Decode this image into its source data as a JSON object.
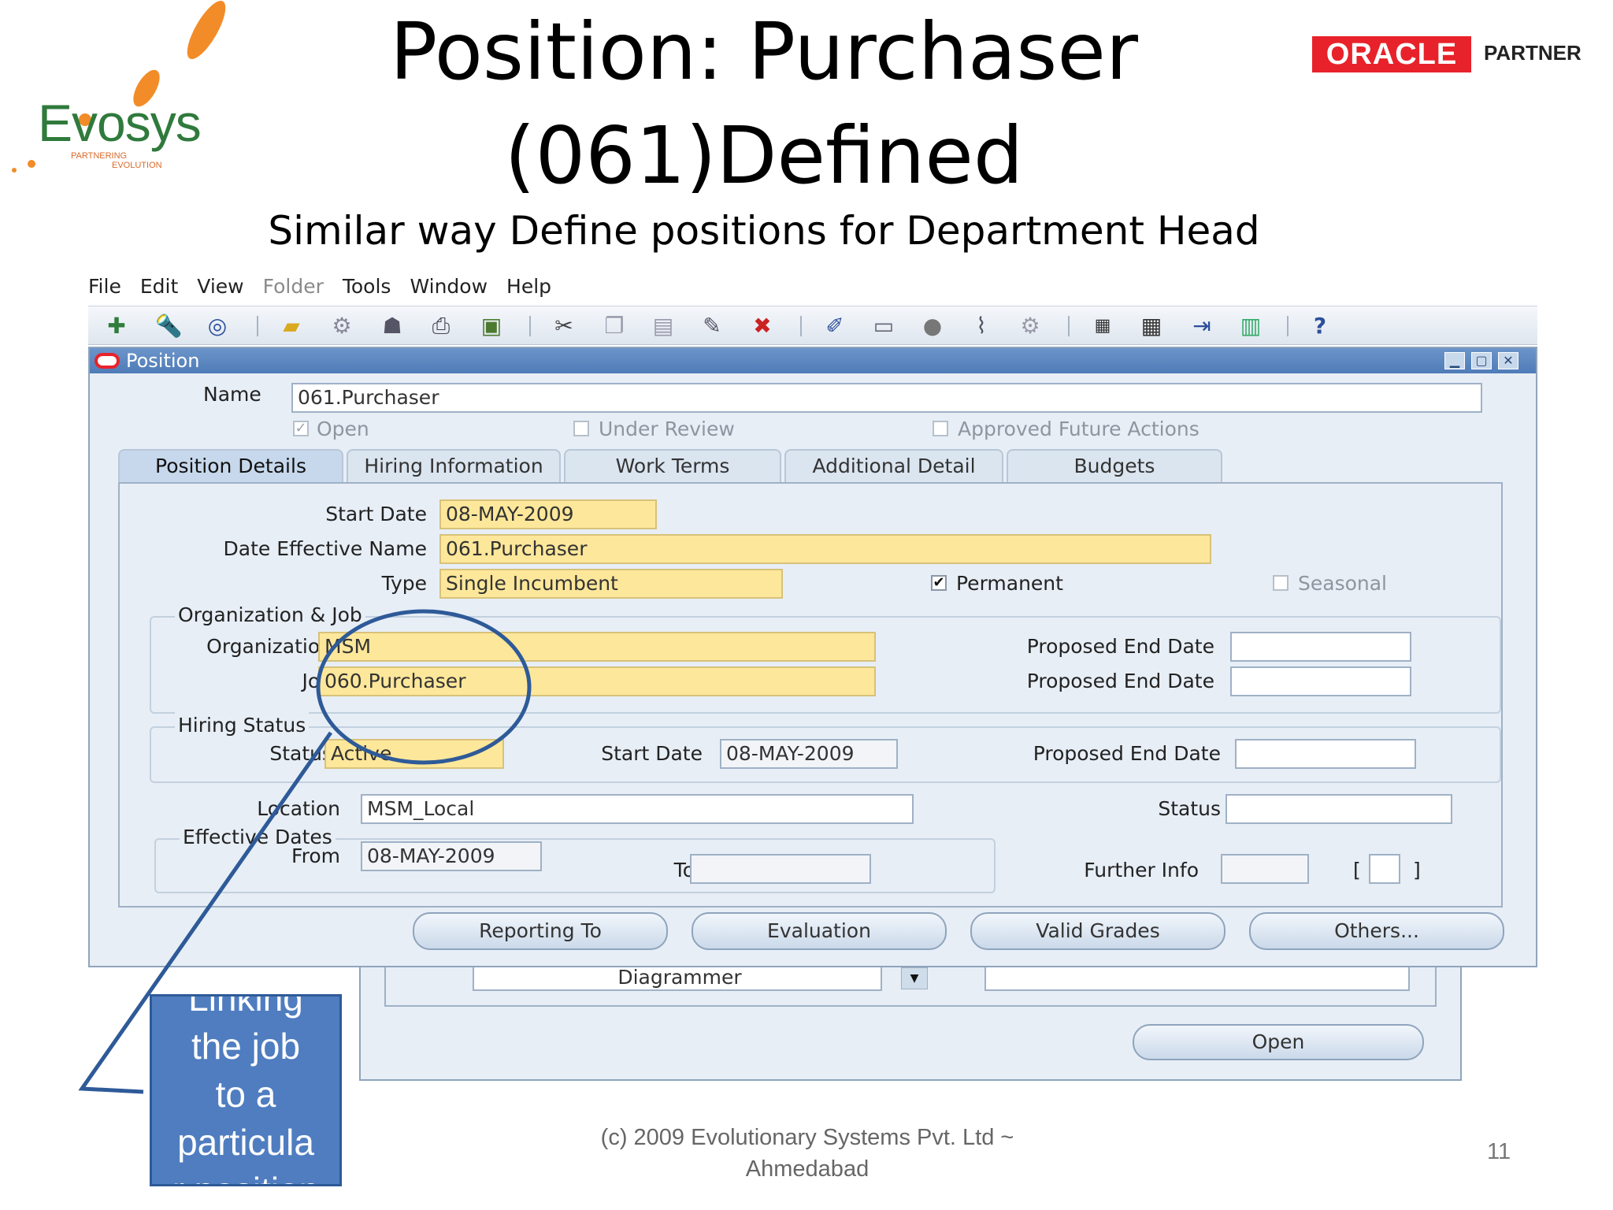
{
  "slide": {
    "title_line1": "Position: Purchaser",
    "title_line2": "(061)Defined",
    "subtitle": "Similar way Define  positions for Department Head",
    "footer_line1": "(c) 2009 Evolutionary Systems Pvt. Ltd ~",
    "footer_line2": "Ahmedabad",
    "page_number": "11",
    "callout_lines": [
      "Linking",
      "the job",
      "to  a",
      "particula",
      "r position"
    ]
  },
  "logos": {
    "evosys_text": "Evosys",
    "evosys_tag_line1": "PARTNERING",
    "evosys_tag_line2": "EVOLUTION",
    "oracle_text": "ORACLE",
    "partner_text": "PARTNER",
    "oracle_color": "#e8222a",
    "evosys_orange": "#f28c28",
    "evosys_green": "#2f7a3c"
  },
  "menu": {
    "items": [
      "File",
      "Edit",
      "View",
      "Folder",
      "Tools",
      "Window",
      "Help"
    ]
  },
  "window": {
    "title": "Position",
    "name_label": "Name",
    "name_value": "061.Purchaser",
    "checkboxes": {
      "open": "Open",
      "under_review": "Under Review",
      "approved_future": "Approved Future Actions"
    },
    "tabs": [
      "Position Details",
      "Hiring Information",
      "Work Terms",
      "Additional Detail",
      "Budgets"
    ],
    "details": {
      "start_date_label": "Start Date",
      "start_date_value": "08-MAY-2009",
      "date_effective_name_label": "Date Effective Name",
      "date_effective_name_value": "061.Purchaser",
      "type_label": "Type",
      "type_value": "Single Incumbent",
      "permanent_label": "Permanent",
      "seasonal_label": "Seasonal",
      "org_job_group": "Organization & Job",
      "organization_label": "Organization",
      "organization_value": "MSM",
      "job_label": "Job",
      "job_value": "060.Purchaser",
      "proposed_end_date_label": "Proposed End Date",
      "hiring_status_group": "Hiring Status",
      "status_label": "Status",
      "status_value": "Active",
      "hs_start_date_label": "Start Date",
      "hs_start_date_value": "08-MAY-2009",
      "location_label": "Location",
      "location_value": "MSM_Local",
      "loc_status_label": "Status",
      "effective_dates_group": "Effective Dates",
      "from_label": "From",
      "from_value": "08-MAY-2009",
      "to_label": "To",
      "further_info_label": "Further Info",
      "bracket_open": "[",
      "bracket_close": "]"
    },
    "buttons": [
      "Reporting To",
      "Evaluation",
      "Valid Grades",
      "Others..."
    ]
  },
  "background_window": {
    "dropdown_value": "Diagrammer",
    "open_button": "Open"
  },
  "toolbar_icons": [
    "new-record-icon",
    "find-icon",
    "navigator-icon",
    "save-icon",
    "next-step-icon",
    "switch-responsibility-icon",
    "print-icon",
    "close-form-icon",
    "cut-icon",
    "copy-icon",
    "paste-icon",
    "clear-record-icon",
    "delete-record-icon",
    "edit-field-icon",
    "zoom-icon",
    "translations-icon",
    "attachments-icon",
    "folder-tools-icon",
    "calendar-icon",
    "calendar2-icon",
    "export-icon",
    "workflow-icon",
    "help-icon"
  ]
}
